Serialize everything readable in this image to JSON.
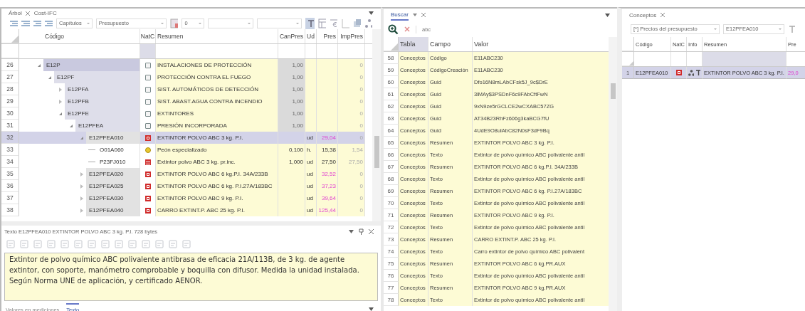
{
  "left_panel": {
    "tabs": [
      {
        "label": "Árbol",
        "closable": true
      },
      {
        "label": "Cost-IFC",
        "closable": false
      }
    ],
    "toolbar": {
      "dropdowns": [
        {
          "value": "Capítulos"
        },
        {
          "value": "Presupuesto"
        },
        {
          "value": "0"
        }
      ]
    },
    "tree": {
      "columns": [
        "Código",
        "NatC",
        "Resumen",
        "CanPres",
        "Ud",
        "Pres",
        "ImpPres"
      ],
      "rows": [
        {
          "num": "26",
          "code": "E12P",
          "kind": "chapter",
          "resumen": "INSTALACIONES DE PROTECCIÓN",
          "canpres": "1,00",
          "imppres": "0",
          "expanded": true,
          "selected": false,
          "children": [
            {
              "num": "27",
              "code": "E12PF",
              "kind": "chapter",
              "resumen": "PROTECCIÓN CONTRA EL FUEGO",
              "canpres": "1,00",
              "imppres": "0",
              "expanded": true,
              "selected": false,
              "children": [
                {
                  "num": "28",
                  "code": "E12PFA",
                  "kind": "chapter",
                  "resumen": "SIST. AUTOMÁTICOS DE DETECCIÓN",
                  "canpres": "1,00",
                  "imppres": "0",
                  "expanded": false,
                  "selected": false
                },
                {
                  "num": "29",
                  "code": "E12PFB",
                  "kind": "chapter",
                  "resumen": "SIST. ABAST.AGUA CONTRA INCENDIO",
                  "canpres": "1,00",
                  "imppres": "0",
                  "expanded": false,
                  "selected": false
                },
                {
                  "num": "30",
                  "code": "E12PFE",
                  "kind": "chapter",
                  "resumen": "EXTINTORES",
                  "canpres": "1,00",
                  "imppres": "0",
                  "expanded": true,
                  "selected": false,
                  "children": [
                    {
                      "num": "31",
                      "code": "E12PFEA",
                      "kind": "chapter",
                      "resumen": "PRESIÓN INCORPORADA",
                      "canpres": "1,00",
                      "imppres": "0",
                      "expanded": true,
                      "selected": false,
                      "children": [
                        {
                          "num": "32",
                          "code": "E12PFEA010",
                          "kind": "item",
                          "resumen": "EXTINTOR POLVO ABC 3 kg. P.I.",
                          "ud": "ud",
                          "pres": "29,04",
                          "imppres": "0",
                          "expanded": true,
                          "selected": true,
                          "children": [
                            {
                              "num": "33",
                              "code": "O01A060",
                              "kind": "labor",
                              "resumen": "Peón especializado",
                              "canpres": "0,100",
                              "ud": "h.",
                              "pres": "15,38",
                              "imppres": "1,54",
                              "selected": false
                            },
                            {
                              "num": "34",
                              "code": "P23FJ010",
                              "kind": "material",
                              "resumen": "Extintor polvo ABC 3 kg. pr.inc.",
                              "canpres": "1,000",
                              "ud": "ud",
                              "pres": "27,50",
                              "imppres": "27,50",
                              "selected": false
                            }
                          ]
                        },
                        {
                          "num": "35",
                          "code": "E12PFEA020",
                          "kind": "item",
                          "resumen": "EXTINTOR POLVO ABC 6 kg.P.I. 34A/233B",
                          "ud": "ud",
                          "pres": "32,52",
                          "imppres": "0",
                          "expanded": false,
                          "selected": false
                        },
                        {
                          "num": "36",
                          "code": "E12PFEA025",
                          "kind": "item",
                          "resumen": "EXTINTOR POLVO ABC 6 kg. P.I.27A/183BC",
                          "ud": "ud",
                          "pres": "37,23",
                          "imppres": "0",
                          "expanded": false,
                          "selected": false
                        },
                        {
                          "num": "37",
                          "code": "E12PFEA030",
                          "kind": "item",
                          "resumen": "EXTINTOR POLVO ABC 9 kg. P.I.",
                          "ud": "ud",
                          "pres": "39,64",
                          "imppres": "0",
                          "expanded": false,
                          "selected": false
                        },
                        {
                          "num": "38",
                          "code": "E12PFEA040",
                          "kind": "item",
                          "resumen": "CARRO EXTINT.P. ABC 25 kg. P.I.",
                          "ud": "ud",
                          "pres": "125,44",
                          "imppres": "0",
                          "expanded": false,
                          "selected": false
                        }
                      ]
                    }
                  ]
                }
              ]
            }
          ]
        }
      ]
    },
    "text_panel": {
      "title": "Texto E12PFEA010 EXTINTOR POLVO ABC 3 kg. P.I. 728 bytes",
      "text": "Extintor de polvo químico ABC polivalente antibrasa de eficacia 21A/113B, de 3 kg. de agente extintor, con soporte, manómetro comprobable y boquilla con difusor. Medida la unidad instalada. Según Norma UNE de aplicación, y certificado AENOR.",
      "tabs": [
        {
          "label": "Valores en mediciones",
          "selected": false
        },
        {
          "label": "Texto",
          "selected": true
        }
      ]
    }
  },
  "search_panel": {
    "tab": "Buscar",
    "search": {
      "placeholder": "abc"
    },
    "columns": [
      "Tabla",
      "Campo",
      "Valor"
    ],
    "rows": [
      {
        "num": "58",
        "tabla": "Conceptos",
        "campo": "Código",
        "valor": "E11ABC230"
      },
      {
        "num": "59",
        "tabla": "Conceptos",
        "campo": "CódigoCreación",
        "valor": "E11ABC230"
      },
      {
        "num": "60",
        "tabla": "Conceptos",
        "campo": "Guid",
        "valor": "Dfo16N8mLAbCFsk5J_9c$DrE"
      },
      {
        "num": "61",
        "tabla": "Conceptos",
        "campo": "Guid",
        "valor": "3lMAy$3PSDnF6c9FAbCftFwN"
      },
      {
        "num": "62",
        "tabla": "Conceptos",
        "campo": "Guid",
        "valor": "9xN9ze5rGCLCE2wCXABC57ZG"
      },
      {
        "num": "63",
        "tabla": "Conceptos",
        "campo": "Guid",
        "valor": "AT34B23RhFz606g3kaBCG7fU"
      },
      {
        "num": "64",
        "tabla": "Conceptos",
        "campo": "Guid",
        "valor": "4UdE9O8ulAbC82N0sF3dF9Bq"
      },
      {
        "num": "65",
        "tabla": "Conceptos",
        "campo": "Resumen",
        "valor": "EXTINTOR POLVO ABC 3 kg. P.I."
      },
      {
        "num": "66",
        "tabla": "Conceptos",
        "campo": "Texto",
        "valor": "Extintor de polvo químico ABC polivalente antil"
      },
      {
        "num": "67",
        "tabla": "Conceptos",
        "campo": "Resumen",
        "valor": "EXTINTOR POLVO ABC 6 kg.P.I. 34A/233B"
      },
      {
        "num": "68",
        "tabla": "Conceptos",
        "campo": "Texto",
        "valor": "Extintor de polvo químico ABC polivalente antil"
      },
      {
        "num": "69",
        "tabla": "Conceptos",
        "campo": "Resumen",
        "valor": "EXTINTOR POLVO ABC 6 kg. P.I.27A/183BC"
      },
      {
        "num": "70",
        "tabla": "Conceptos",
        "campo": "Texto",
        "valor": "Extintor de polvo químico ABC polivalente antil"
      },
      {
        "num": "71",
        "tabla": "Conceptos",
        "campo": "Resumen",
        "valor": "EXTINTOR POLVO ABC 9 kg. P.I."
      },
      {
        "num": "72",
        "tabla": "Conceptos",
        "campo": "Texto",
        "valor": "Extintor de polvo químico ABC polivalente antil"
      },
      {
        "num": "73",
        "tabla": "Conceptos",
        "campo": "Resumen",
        "valor": "CARRO EXTINT.P. ABC 25 kg. P.I."
      },
      {
        "num": "74",
        "tabla": "Conceptos",
        "campo": "Texto",
        "valor": "Carro extintor de polvo químico ABC polivalent"
      },
      {
        "num": "75",
        "tabla": "Conceptos",
        "campo": "Resumen",
        "valor": "EXTINTOR POLVO ABC 6 kg.PR.AUX"
      },
      {
        "num": "76",
        "tabla": "Conceptos",
        "campo": "Texto",
        "valor": "Extintor de polvo químico ABC polivalente antil"
      },
      {
        "num": "77",
        "tabla": "Conceptos",
        "campo": "Resumen",
        "valor": "EXTINTOR POLVO ABC 9 kg.PR.AUX"
      },
      {
        "num": "78",
        "tabla": "Conceptos",
        "campo": "Texto",
        "valor": "Extintor de polvo químico ABC polivalente antil"
      }
    ]
  },
  "concepts_panel": {
    "tab": "Conceptos",
    "dropdowns": [
      {
        "value": "[*] Precios del presupuesto"
      },
      {
        "value": "E12PFEA010"
      }
    ],
    "columns": [
      "Código",
      "NatC",
      "Info",
      "Resumen",
      "Pre"
    ],
    "rows": [
      {
        "num": "1",
        "code": "E12PFEA010",
        "kind": "item",
        "resumen": "EXTINTOR POLVO ABC 3 kg. P.I.",
        "pres": "29,0",
        "selected": true
      }
    ]
  }
}
